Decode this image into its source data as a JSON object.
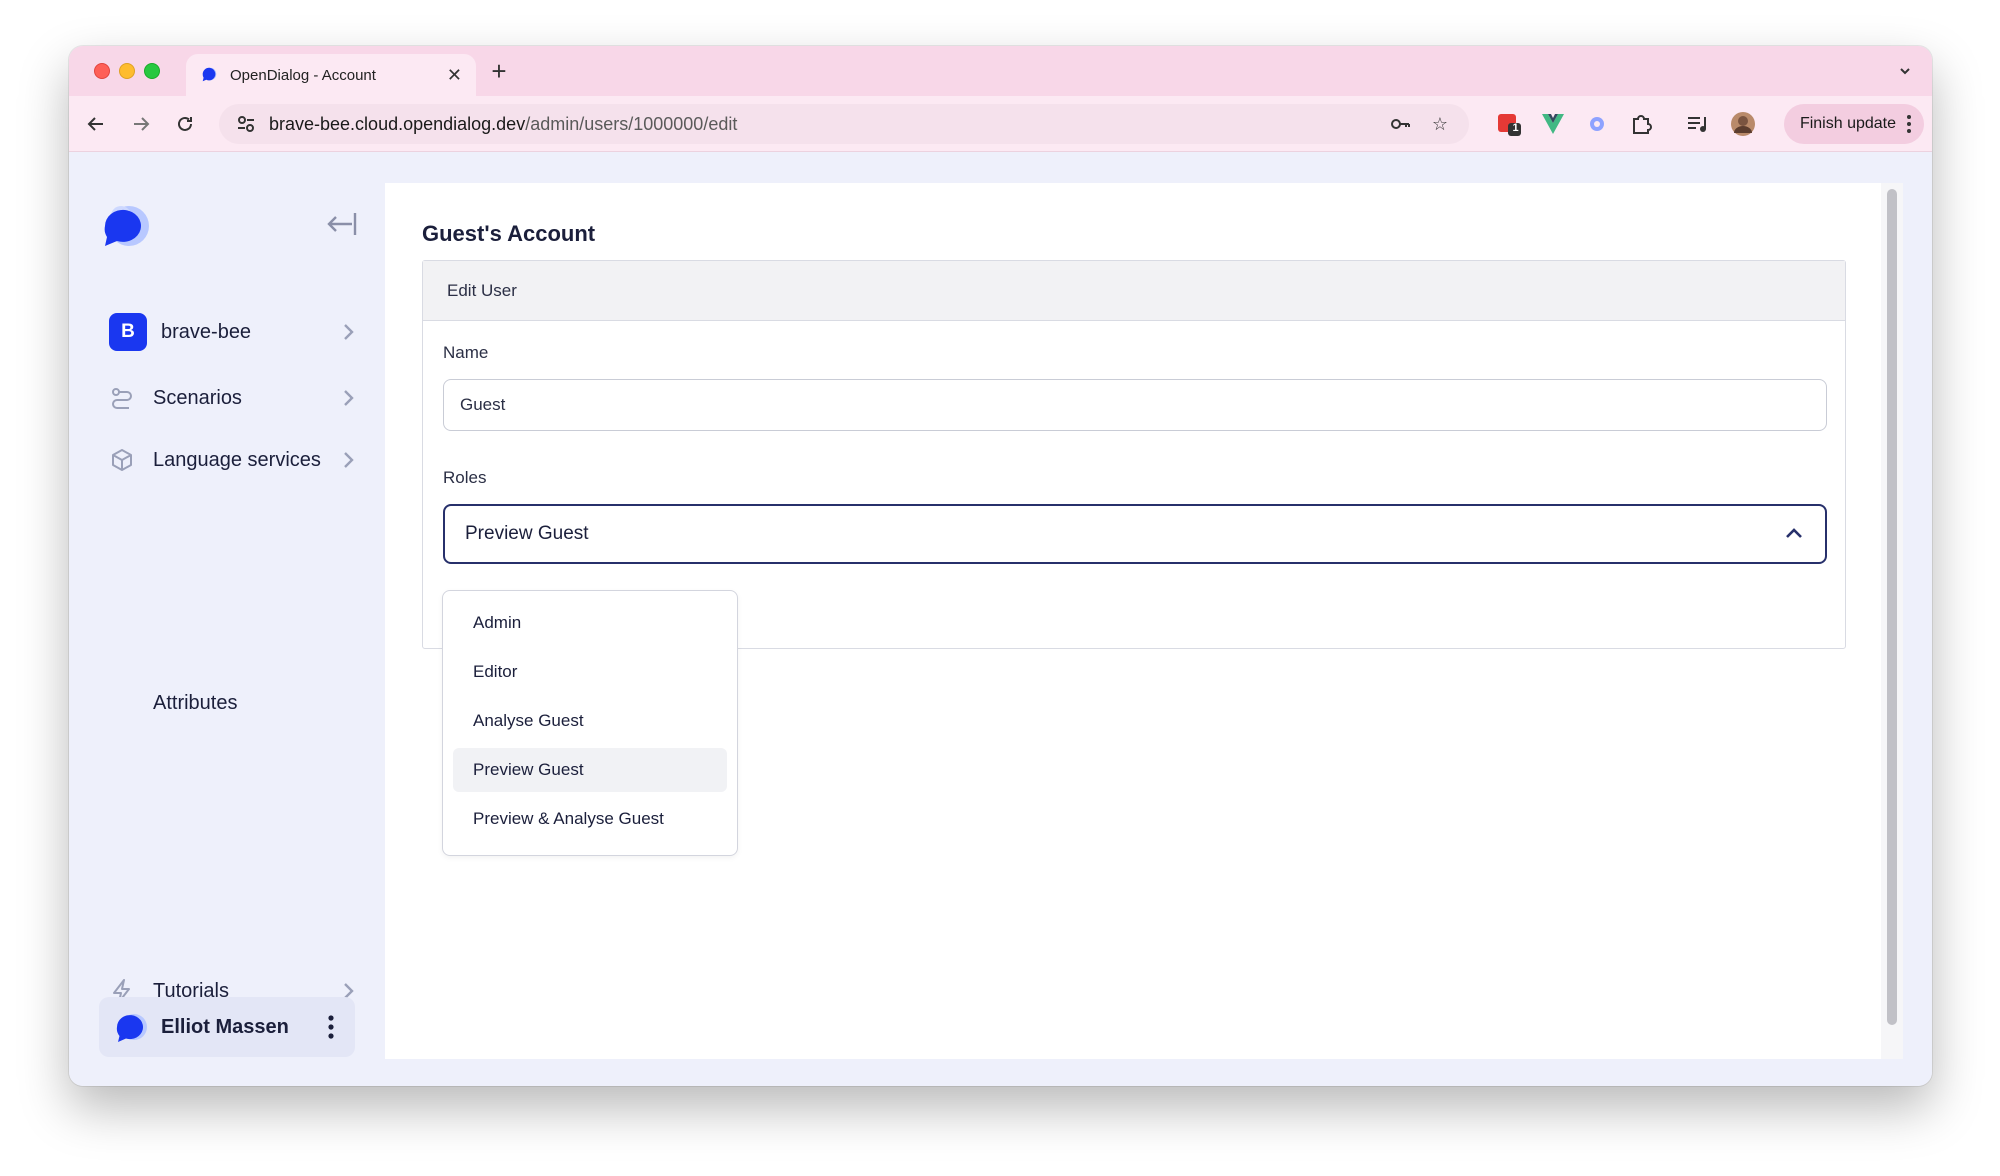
{
  "browser": {
    "tab_title": "OpenDialog - Account",
    "url_host": "brave-bee.cloud.opendialog.dev",
    "url_path": "/admin/users/1000000/edit",
    "finish_update_label": "Finish update",
    "extension_badge_count": "1"
  },
  "sidebar": {
    "workspace": {
      "initial": "B",
      "label": "brave-bee"
    },
    "items": [
      {
        "label": "Scenarios",
        "icon": "route-icon"
      },
      {
        "label": "Language services",
        "icon": "cube-icon"
      },
      {
        "label": "Attributes",
        "icon": ""
      },
      {
        "label": "Tutorials",
        "icon": "lightning-icon"
      }
    ],
    "user": {
      "name": "Elliot Massen"
    }
  },
  "main": {
    "page_title": "Guest's Account",
    "card_title": "Edit User",
    "name_label": "Name",
    "name_value": "Guest",
    "roles_label": "Roles",
    "roles_selected": "Preview Guest",
    "role_options": [
      "Admin",
      "Editor",
      "Analyse Guest",
      "Preview Guest",
      "Preview & Analyse Guest"
    ]
  },
  "colors": {
    "tabstrip": "#f8d7e8",
    "accent_blue": "#1a37f0",
    "select_border": "#27306b",
    "app_background": "#eef0fb"
  }
}
